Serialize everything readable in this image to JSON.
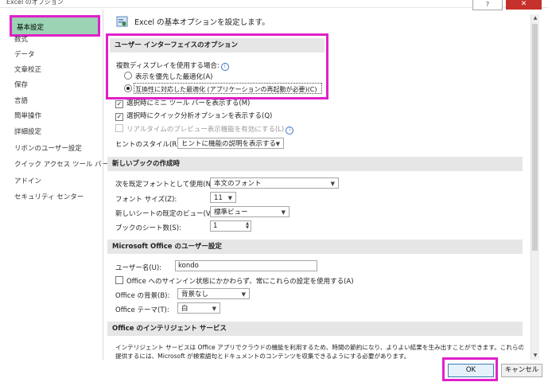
{
  "window": {
    "title": "Excel のオプション",
    "help": "?",
    "close": "✕"
  },
  "sidebar": {
    "items": [
      "基本設定",
      "数式",
      "データ",
      "文章校正",
      "保存",
      "言語",
      "簡単操作",
      "詳細設定",
      "リボンのユーザー設定",
      "クイック アクセス ツール バー",
      "アドイン",
      "セキュリティ センター"
    ],
    "selected": 0
  },
  "main": {
    "heading": "Excel の基本オプションを設定します。",
    "ui_options": {
      "title": "ユーザー インターフェイスのオプション",
      "multi_display_label": "複数ディスプレイを使用する場合:",
      "radio_display": "表示を優先した最適化(A)",
      "radio_compat": "互換性に対応した最適化 (アプリケーションの再起動が必要)(C)",
      "mini_toolbar": "選択時にミニ ツール バーを表示する(M)",
      "quick_analysis": "選択時にクイック分析オプションを表示する(Q)",
      "live_preview": "リアルタイムのプレビュー表示機能を有効にする(L)",
      "tooltip_label": "ヒントのスタイル(R):",
      "tooltip_value": "ヒントに機能の説明を表示する"
    },
    "new_workbook": {
      "title": "新しいブックの作成時",
      "font_label": "次を既定フォントとして使用(N):",
      "font_value": "本文のフォント",
      "size_label": "フォント サイズ(Z):",
      "size_value": "11",
      "view_label": "新しいシートの既定のビュー(V):",
      "view_value": "標準ビュー",
      "sheets_label": "ブックのシート数(S):",
      "sheets_value": "1"
    },
    "personalize": {
      "title": "Microsoft Office のユーザー設定",
      "username_label": "ユーザー名(U):",
      "username_value": "kondo",
      "signin_check": "Office へのサインイン状態にかかわらず、常にこれらの設定を使用する(A)",
      "background_label": "Office の背景(B):",
      "background_value": "背景なし",
      "theme_label": "Office テーマ(T):",
      "theme_value": "白"
    },
    "intelligent": {
      "title": "Office のインテリジェント サービス",
      "line1": "インテリジェント サービスは Office アプリでクラウドの機能を利用するため、時間の節約になり、よりよい結果を生み出すことができます。これらのサービスを",
      "line2": "提供するには、Microsoft が検索語句とドキュメントのコンテンツを収集できるようにする必要があります。"
    }
  },
  "footer": {
    "ok": "OK",
    "cancel": "キャンセル"
  },
  "colors": {
    "highlight": "#e020c8",
    "selected_nav": "#9bd3b4",
    "section_bg": "#e6e6e6"
  }
}
